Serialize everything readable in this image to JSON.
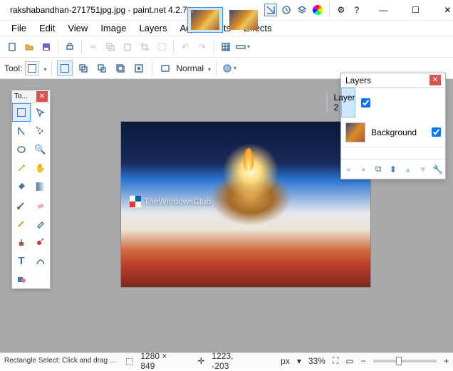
{
  "title": "rakshabandhan-271751jpg.jpg - paint.net 4.2.7",
  "menu": [
    "File",
    "Edit",
    "View",
    "Image",
    "Layers",
    "Adjustments",
    "Effects"
  ],
  "optbar": {
    "tool_label": "Tool:",
    "blend_label": "Normal"
  },
  "tools_window": {
    "title": "To..."
  },
  "layers_window": {
    "title": "Layers",
    "items": [
      {
        "name": "Layer 2",
        "checked": true,
        "selected": true,
        "thumb": "checker"
      },
      {
        "name": "Background",
        "checked": true,
        "selected": false,
        "thumb": "img"
      }
    ]
  },
  "watermark": "TheWindowsClub",
  "status": {
    "hint": "Rectangle Select: Click and drag to draw a rectangular selection. Hol...",
    "dims": "1280 × 849",
    "cursor": "1223, -203",
    "unit": "px",
    "zoom_sep": "▾",
    "zoom": "33%"
  }
}
